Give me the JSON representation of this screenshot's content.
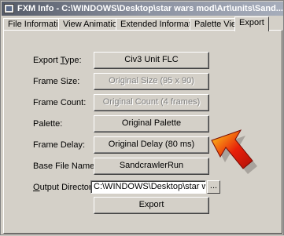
{
  "window": {
    "title": "FXM Info - C:\\WINDOWS\\Desktop\\star wars mod\\Art\\units\\Sand..."
  },
  "tabs": [
    {
      "label": "File Information"
    },
    {
      "label": "View Animation"
    },
    {
      "label": "Extended Information"
    },
    {
      "label": "Palette View"
    },
    {
      "label": "Export"
    }
  ],
  "form": {
    "export_type": {
      "label_pre": "Export ",
      "label_key": "T",
      "label_post": "ype:",
      "value": "Civ3 Unit FLC"
    },
    "frame_size": {
      "label": "Frame Size:",
      "value": "Original Size (95 x 90)"
    },
    "frame_count": {
      "label": "Frame Count:",
      "value": "Original Count (4 frames)"
    },
    "palette": {
      "label": "Palette:",
      "value": "Original Palette"
    },
    "frame_delay": {
      "label": "Frame Delay:",
      "value": "Original Delay (80 ms)"
    },
    "base_file_name": {
      "label": "Base File Name:",
      "value": "SandcrawlerRun"
    },
    "output_directory": {
      "label_key": "O",
      "label_post": "utput Directory",
      "value": "C:\\WINDOWS\\Desktop\\star wars",
      "browse_label": "..."
    },
    "export_button": "Export"
  },
  "annotation": {
    "arrow_color": "#e8200a",
    "arrow_highlight": "#ffd21a"
  }
}
